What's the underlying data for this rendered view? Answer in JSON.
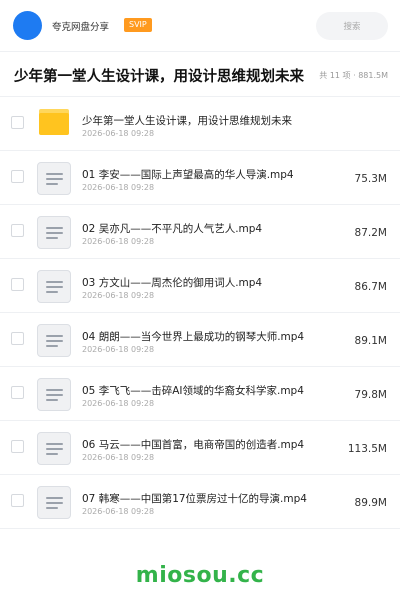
{
  "header": {
    "brand_name": "夸克网盘分享",
    "svip_label": "SVIP",
    "search_placeholder": "搜索"
  },
  "title_bar": {
    "title": "少年第一堂人生设计课，用设计思维规划未来",
    "meta": "共 11 项 · 881.5M"
  },
  "files": [
    {
      "name": "少年第一堂人生设计课，用设计思维规划未来",
      "date": "2026-06-18 09:28",
      "size": "",
      "type": "folder"
    },
    {
      "name": "01 李安——国际上声望最高的华人导演.mp4",
      "date": "2026-06-18 09:28",
      "size": "75.3M",
      "type": "video"
    },
    {
      "name": "02 吴亦凡——不平凡的人气艺人.mp4",
      "date": "2026-06-18 09:28",
      "size": "87.2M",
      "type": "video"
    },
    {
      "name": "03 方文山——周杰伦的御用词人.mp4",
      "date": "2026-06-18 09:28",
      "size": "86.7M",
      "type": "video"
    },
    {
      "name": "04 朗朗——当今世界上最成功的钢琴大师.mp4",
      "date": "2026-06-18 09:28",
      "size": "89.1M",
      "type": "video"
    },
    {
      "name": "05 李飞飞——击碎AI领域的华裔女科学家.mp4",
      "date": "2026-06-18 09:28",
      "size": "79.8M",
      "type": "video"
    },
    {
      "name": "06 马云——中国首富，电商帝国的创造者.mp4",
      "date": "2026-06-18 09:28",
      "size": "113.5M",
      "type": "video"
    },
    {
      "name": "07 韩寒——中国第17位票房过十亿的导演.mp4",
      "date": "2026-06-18 09:28",
      "size": "89.9M",
      "type": "video"
    }
  ],
  "watermark": "miosou.cc",
  "colors": {
    "brand_blue": "#1e7bf2",
    "svip_orange": "#ff9a1f",
    "folder_yellow": "#ffc41f",
    "watermark_green": "#33b34a"
  }
}
